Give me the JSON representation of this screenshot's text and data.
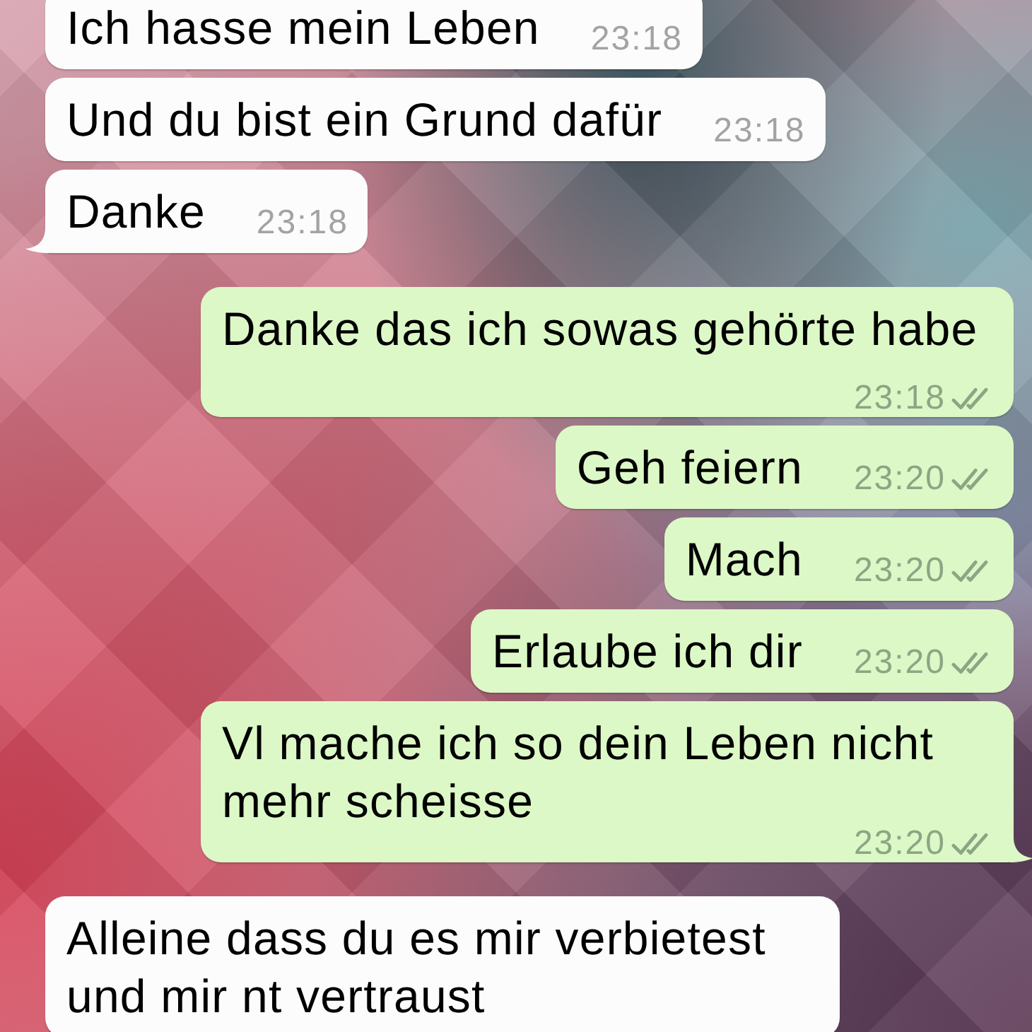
{
  "messages": [
    {
      "kind": "incoming",
      "text": "Ich hasse mein Leben",
      "time": "23:18",
      "tail": false
    },
    {
      "kind": "incoming",
      "text": "Und du bist ein Grund dafür",
      "time": "23:18",
      "tail": false
    },
    {
      "kind": "incoming",
      "text": "Danke",
      "time": "23:18",
      "tail": true
    },
    {
      "kind": "outgoing",
      "text": "Danke das ich sowas gehörte habe",
      "time": "23:18",
      "delivered": true,
      "read": false,
      "tail": false
    },
    {
      "kind": "outgoing",
      "text": "Geh feiern",
      "time": "23:20",
      "delivered": true,
      "read": false,
      "tail": false
    },
    {
      "kind": "outgoing",
      "text": "Mach",
      "time": "23:20",
      "delivered": true,
      "read": false,
      "tail": false
    },
    {
      "kind": "outgoing",
      "text": "Erlaube ich dir",
      "time": "23:20",
      "delivered": true,
      "read": false,
      "tail": false
    },
    {
      "kind": "outgoing",
      "text": "Vl mache ich so dein Leben nicht mehr scheisse",
      "time": "23:20",
      "delivered": true,
      "read": false,
      "tail": true
    },
    {
      "kind": "incoming",
      "text": "Alleine dass du es mir verbietest und mir nt vertraust",
      "tail": false
    }
  ]
}
